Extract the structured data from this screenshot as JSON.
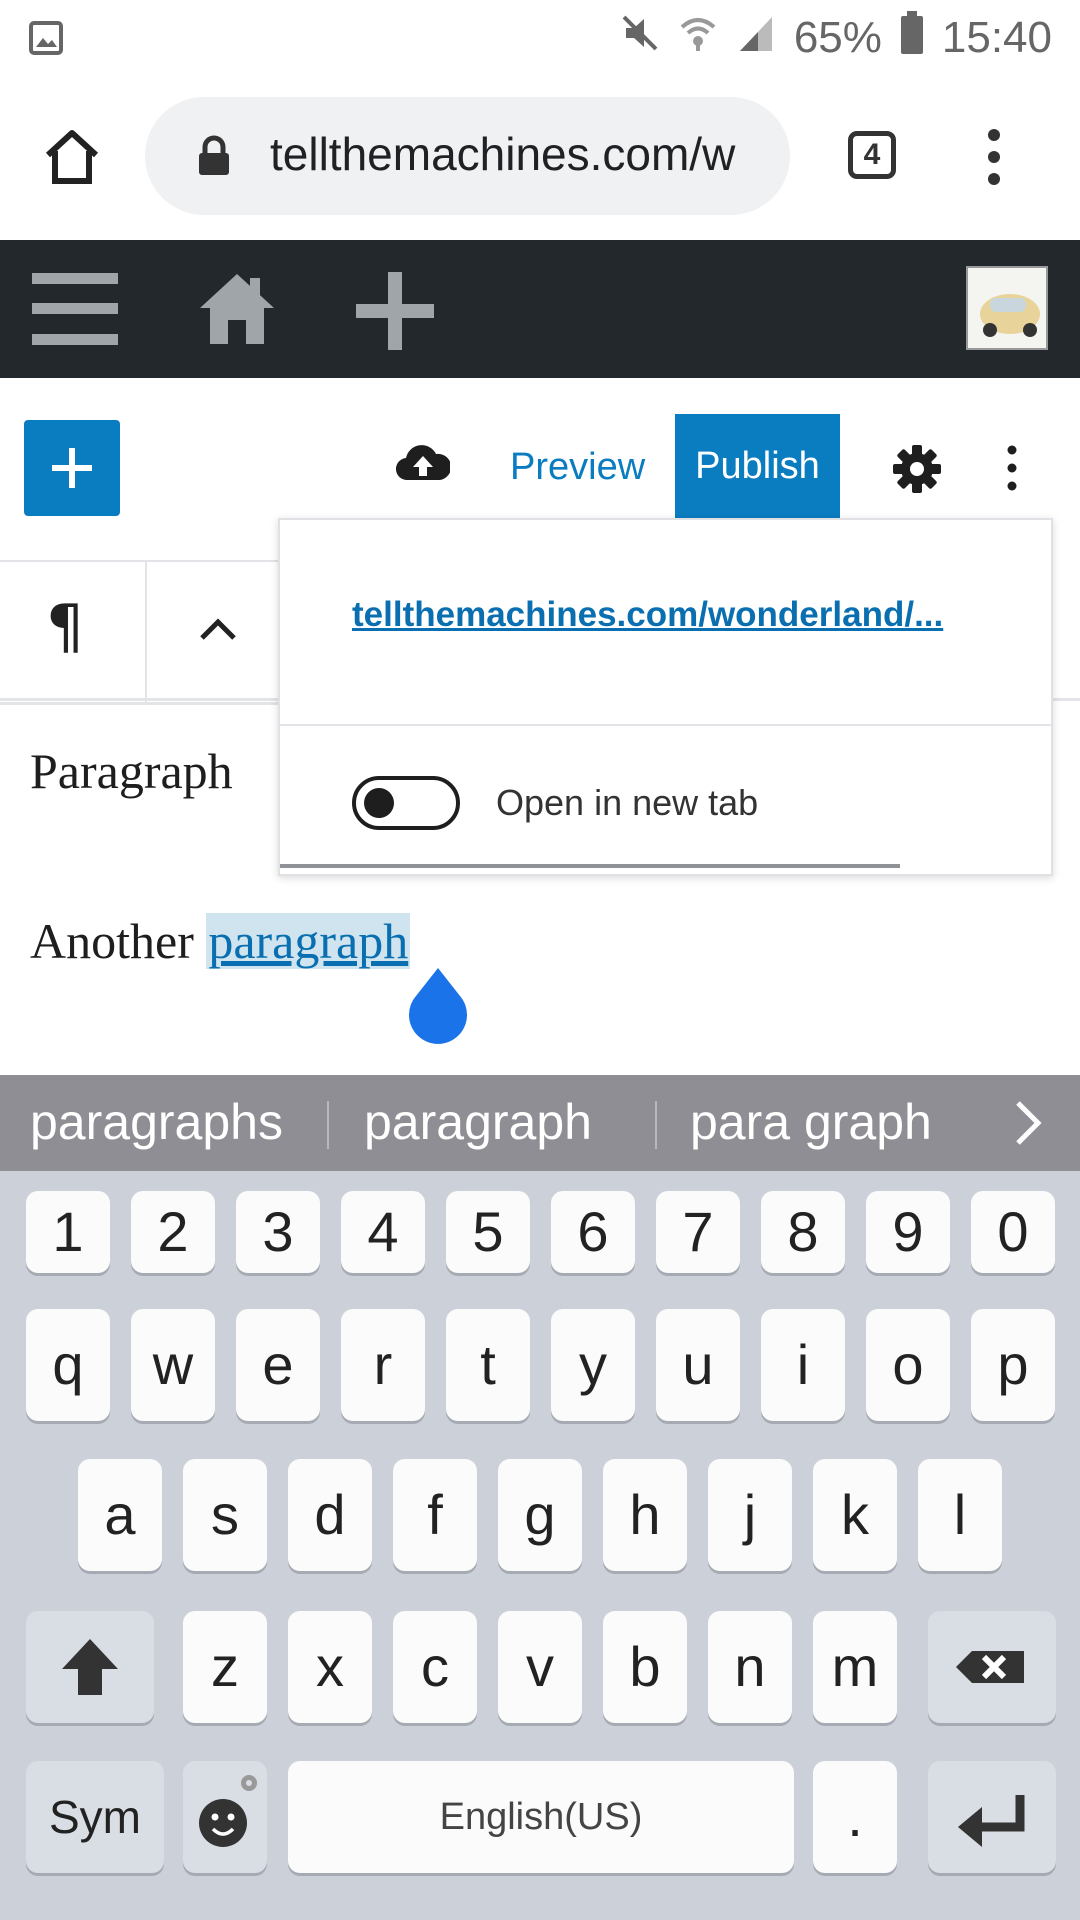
{
  "status_bar": {
    "battery": "65%",
    "time": "15:40"
  },
  "browser": {
    "url": "tellthemachines.com/w",
    "tab_count": "4"
  },
  "editor_toolbar": {
    "preview_label": "Preview",
    "publish_label": "Publish"
  },
  "block_toolbar": {
    "block_type_symbol": "¶"
  },
  "content": {
    "paragraph1": "Paragraph",
    "paragraph2_prefix": "Another ",
    "paragraph2_link": "paragraph"
  },
  "link_popover": {
    "url": "tellthemachines.com/wonderland/...",
    "toggle_label": "Open in new tab"
  },
  "keyboard": {
    "suggestions": [
      "paragraphs",
      "paragraph",
      "para graph"
    ],
    "number_row": [
      "1",
      "2",
      "3",
      "4",
      "5",
      "6",
      "7",
      "8",
      "9",
      "0"
    ],
    "row1": [
      "q",
      "w",
      "e",
      "r",
      "t",
      "y",
      "u",
      "i",
      "o",
      "p"
    ],
    "row2": [
      "a",
      "s",
      "d",
      "f",
      "g",
      "h",
      "j",
      "k",
      "l"
    ],
    "row3": [
      "z",
      "x",
      "c",
      "v",
      "b",
      "n",
      "m"
    ],
    "sym_label": "Sym",
    "space_label": "English(US)",
    "period_label": "."
  },
  "colors": {
    "wp_blue": "#0a7cc0",
    "admin_bar": "#23282d",
    "keyboard_bg": "#ccd1d9",
    "suggestion_bar": "#8e8e94"
  }
}
